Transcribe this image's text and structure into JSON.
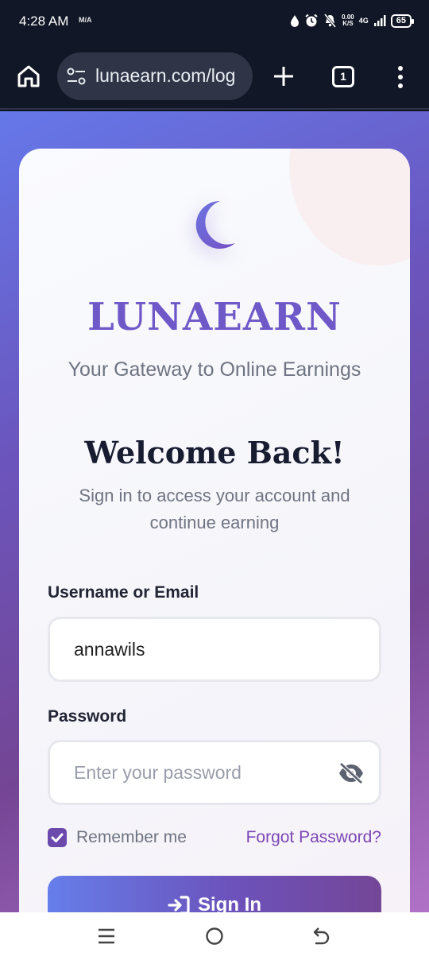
{
  "status_bar": {
    "time": "4:28 AM",
    "mini_indicator": "M/A",
    "speed_top": "0.00",
    "speed_bottom": "K/S",
    "network": "4G",
    "battery": "65",
    "icons": [
      "water-drop-icon",
      "alarm-icon",
      "bell-off-icon",
      "signal-icon",
      "battery-icon"
    ]
  },
  "browser": {
    "url": "lunaearn.com/log",
    "tab_count": "1",
    "icons": [
      "home-icon",
      "site-settings-icon",
      "plus-icon",
      "tabs-icon",
      "more-vert-icon"
    ]
  },
  "login": {
    "brand": "LUNAEARN",
    "tagline": "Your Gateway to Online Earnings",
    "heading": "Welcome Back!",
    "subtitle": "Sign in to access your account and continue earning",
    "username_label": "Username or Email",
    "username_value": "annawils",
    "password_label": "Password",
    "password_placeholder": "Enter your password",
    "remember_label": "Remember me",
    "remember_checked": true,
    "forgot_label": "Forgot Password?",
    "signin_label": "Sign In"
  },
  "colors": {
    "brand": "#6f58c8",
    "accent": "#7c47b5",
    "gradient_start": "#667eea",
    "gradient_end": "#744697",
    "checkbox": "#6b49ad"
  },
  "navbar": {
    "icons": [
      "recents-icon",
      "home-circle-icon",
      "back-icon"
    ]
  }
}
